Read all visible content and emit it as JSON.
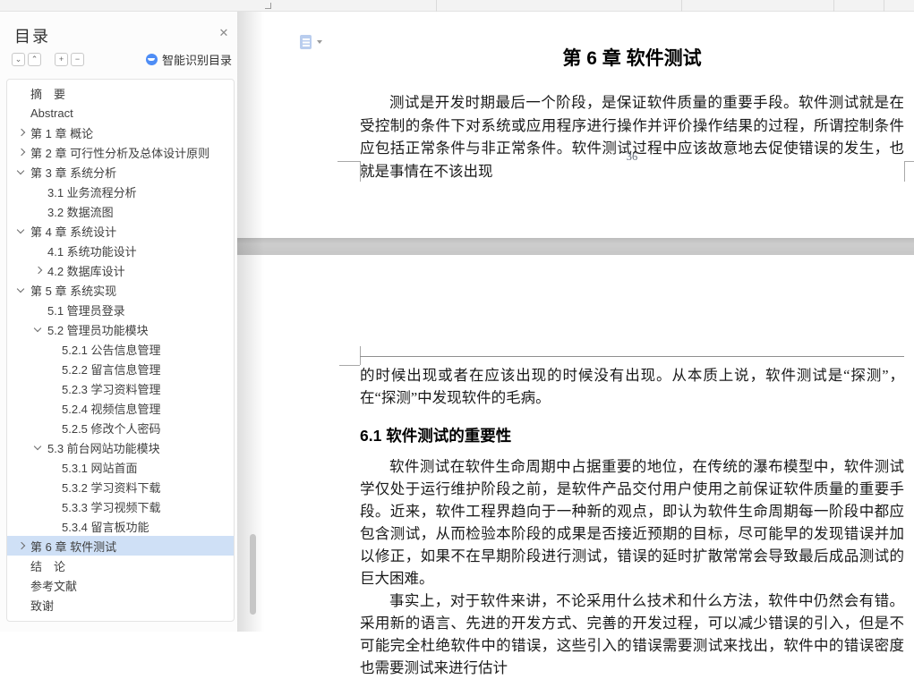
{
  "colors": {
    "accent": "#4e8df5",
    "highlight": "#cfe0f6",
    "page_gap": "#c9c9c9",
    "margin_mark": "#a8a8a8"
  },
  "sidebar": {
    "title": "目录",
    "close_label": "✕",
    "toolbar": [
      {
        "name": "expand-down-button",
        "glyph": "⌄"
      },
      {
        "name": "collapse-up-button",
        "glyph": "⌃"
      },
      {
        "name": "expand-all-button",
        "glyph": "+"
      },
      {
        "name": "collapse-all-button",
        "glyph": "−"
      }
    ],
    "smart_button_label": "智能识别目录",
    "items": [
      {
        "label": "摘　要",
        "level": 0,
        "chevron": "none",
        "selected": false
      },
      {
        "label": "Abstract",
        "level": 0,
        "chevron": "none",
        "selected": false
      },
      {
        "label": "第 1 章 概论",
        "level": 0,
        "chevron": "right",
        "selected": false
      },
      {
        "label": "第 2 章 可行性分析及总体设计原则",
        "level": 0,
        "chevron": "right",
        "selected": false
      },
      {
        "label": "第 3 章 系统分析",
        "level": 0,
        "chevron": "down",
        "selected": false
      },
      {
        "label": "3.1 业务流程分析",
        "level": 1,
        "chevron": "none",
        "selected": false
      },
      {
        "label": "3.2 数据流图",
        "level": 1,
        "chevron": "none",
        "selected": false
      },
      {
        "label": "第 4 章 系统设计",
        "level": 0,
        "chevron": "down",
        "selected": false
      },
      {
        "label": "4.1 系统功能设计",
        "level": 1,
        "chevron": "none",
        "selected": false
      },
      {
        "label": "4.2 数据库设计",
        "level": 1,
        "chevron": "right",
        "selected": false
      },
      {
        "label": "第 5 章 系统实现",
        "level": 0,
        "chevron": "down",
        "selected": false
      },
      {
        "label": "5.1 管理员登录",
        "level": 1,
        "chevron": "none",
        "selected": false
      },
      {
        "label": "5.2 管理员功能模块",
        "level": 1,
        "chevron": "down",
        "selected": false
      },
      {
        "label": "5.2.1 公告信息管理",
        "level": 2,
        "chevron": "none",
        "selected": false
      },
      {
        "label": "5.2.2 留言信息管理",
        "level": 2,
        "chevron": "none",
        "selected": false
      },
      {
        "label": "5.2.3 学习资料管理",
        "level": 2,
        "chevron": "none",
        "selected": false
      },
      {
        "label": "5.2.4 视频信息管理",
        "level": 2,
        "chevron": "none",
        "selected": false
      },
      {
        "label": "5.2.5 修改个人密码",
        "level": 2,
        "chevron": "none",
        "selected": false
      },
      {
        "label": "5.3 前台网站功能模块",
        "level": 1,
        "chevron": "down",
        "selected": false
      },
      {
        "label": "5.3.1 网站首面",
        "level": 2,
        "chevron": "none",
        "selected": false
      },
      {
        "label": "5.3.2 学习资料下载",
        "level": 2,
        "chevron": "none",
        "selected": false
      },
      {
        "label": "5.3.3 学习视频下载",
        "level": 2,
        "chevron": "none",
        "selected": false
      },
      {
        "label": "5.3.4 留言板功能",
        "level": 2,
        "chevron": "none",
        "selected": false
      },
      {
        "label": "第 6 章 软件测试",
        "level": 0,
        "chevron": "right",
        "selected": true
      },
      {
        "label": " 结　论",
        "level": 0,
        "chevron": "none",
        "selected": false
      },
      {
        "label": "参考文献",
        "level": 0,
        "chevron": "none",
        "selected": false
      },
      {
        "label": "致谢",
        "level": 0,
        "chevron": "none",
        "selected": false
      }
    ]
  },
  "document": {
    "page36": {
      "chapter_title": "第 6 章 软件测试",
      "paragraph": "测试是开发时期最后一个阶段，是保证软件质量的重要手段。软件测试就是在受控制的条件下对系统或应用程序进行操作并评价操作结果的过程，所谓控制条件应包括正常条件与非正常条件。软件测试过程中应该故意地去促使错误的发生，也就是事情在不该出现",
      "page_number": "36"
    },
    "page37": {
      "paragraph_continued": "的时候出现或者在应该出现的时候没有出现。从本质上说，软件测试是“探测”，在“探测”中发现软件的毛病。",
      "section_heading": "6.1 软件测试的重要性",
      "paragraph1": "软件测试在软件生命周期中占据重要的地位，在传统的瀑布模型中，软件测试学仅处于运行维护阶段之前，是软件产品交付用户使用之前保证软件质量的重要手段。近来，软件工程界趋向于一种新的观点，即认为软件生命周期每一阶段中都应包含测试，从而检验本阶段的成果是否接近预期的目标，尽可能早的发现错误并加以修正，如果不在早期阶段进行测试，错误的延时扩散常常会导致最后成品测试的巨大困难。",
      "paragraph2": "事实上，对于软件来讲，不论采用什么技术和什么方法，软件中仍然会有错。采用新的语言、先进的开发方式、完善的开发过程，可以减少错误的引入，但是不可能完全杜绝软件中的错误，这些引入的错误需要测试来找出，软件中的错误密度也需要测试来进行估计"
    }
  }
}
